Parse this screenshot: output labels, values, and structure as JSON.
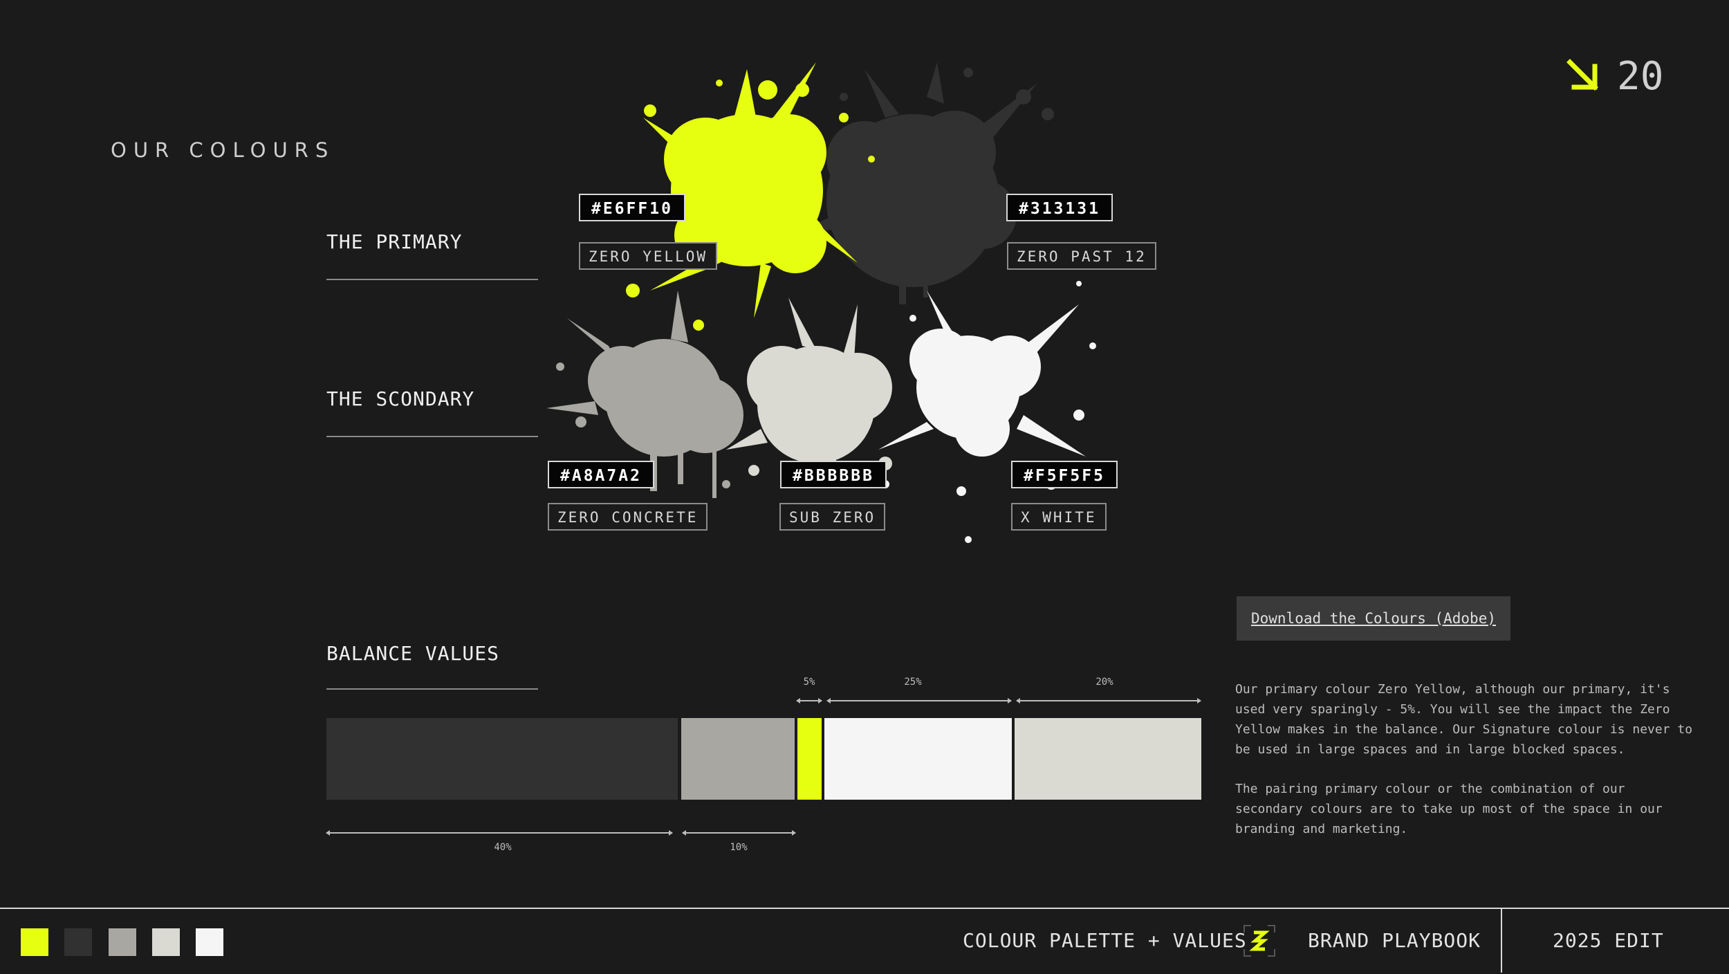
{
  "header": {
    "title": "OUR COLOURS",
    "page_number": "20",
    "accent": "#E6FF10",
    "icon": "arrow-down-right-icon"
  },
  "sections": {
    "primary_label": "THE PRIMARY",
    "secondary_label": "THE SCONDARY",
    "balance_label": "BALANCE VALUES"
  },
  "colours": {
    "primary": [
      {
        "hex": "#E6FF10",
        "name": "ZERO YELLOW"
      },
      {
        "hex": "#313131",
        "name": "ZERO PAST 12"
      }
    ],
    "secondary": [
      {
        "hex": "#A8A7A2",
        "name": "ZERO CONCRETE"
      },
      {
        "hex": "#BBBBBB",
        "name": "SUB ZERO"
      },
      {
        "hex": "#F5F5F5",
        "name": "X WHITE"
      }
    ]
  },
  "balance": {
    "segments": [
      {
        "percent": "40%",
        "value": 40,
        "color": "#313131"
      },
      {
        "percent": "10%",
        "value": 10,
        "color": "#A8A7A2"
      },
      {
        "percent": "5%",
        "value": 5,
        "color": "#E6FF10"
      },
      {
        "percent": "25%",
        "value": 25,
        "color": "#F5F5F5"
      },
      {
        "percent": "20%",
        "value": 20,
        "color": "#DADAD3"
      }
    ]
  },
  "download": {
    "label": "Download the Colours (Adobe)"
  },
  "description": {
    "paragraph_1": "Our primary colour Zero Yellow, although our primary, it's used very sparingly - 5%. You will see the impact the Zero Yellow makes in the balance. Our Signature colour is never to be used in large spaces and in  large blocked spaces.",
    "paragraph_2": "The pairing primary colour or the combination of our secondary colours are to take up most of the space in our branding and marketing."
  },
  "footer": {
    "section": "COLOUR PALETTE + VALUES",
    "brand": "BRAND PLAYBOOK",
    "edition": "2025 EDIT",
    "logo_icon": "brand-logo-icon",
    "swatches": [
      "#E6FF10",
      "#313131",
      "#A8A7A2",
      "#DADAD3",
      "#F5F5F5"
    ]
  }
}
